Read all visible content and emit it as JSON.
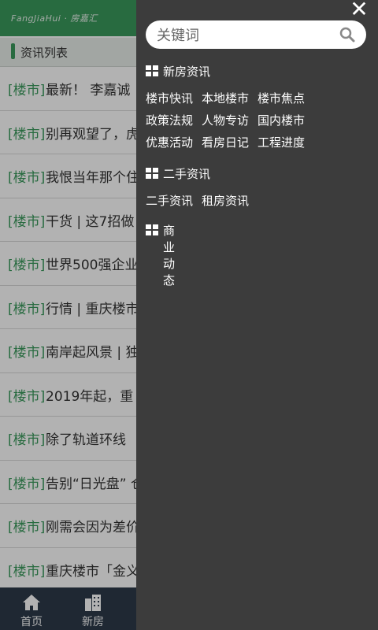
{
  "header": {
    "logo": "FangJiaHui · 房嘉汇"
  },
  "section": {
    "title": "资讯列表"
  },
  "news": [
    {
      "tag": "[楼市]",
      "title": "最新！ 李嘉诚"
    },
    {
      "tag": "[楼市]",
      "title": "别再观望了，虎"
    },
    {
      "tag": "[楼市]",
      "title": "我恨当年那个住"
    },
    {
      "tag": "[楼市]",
      "title": "干货 | 这7招做"
    },
    {
      "tag": "[楼市]",
      "title": "世界500强企业"
    },
    {
      "tag": "[楼市]",
      "title": "行情 | 重庆楼市"
    },
    {
      "tag": "[楼市]",
      "title": "南岸起风景 | 独"
    },
    {
      "tag": "[楼市]",
      "title": "2019年起，重"
    },
    {
      "tag": "[楼市]",
      "title": "除了轨道环线"
    },
    {
      "tag": "[楼市]",
      "title": "告别“日光盘” 仓"
    },
    {
      "tag": "[楼市]",
      "title": "刚需会因为差价"
    },
    {
      "tag": "[楼市]",
      "title": "重庆楼市「金义"
    }
  ],
  "bottom_nav": [
    {
      "label": "首页",
      "icon": "home-icon"
    },
    {
      "label": "新房",
      "icon": "building-icon"
    }
  ],
  "drawer": {
    "close": "✕",
    "search_placeholder": "关键词",
    "categories": [
      {
        "name": "新房资讯",
        "rows": [
          [
            "楼市快讯",
            "本地楼市",
            "楼市焦点"
          ],
          [
            "政策法规",
            "人物专访",
            "国内楼市"
          ],
          [
            "优惠活动",
            "看房日记",
            "工程进度"
          ]
        ]
      },
      {
        "name": "二手资讯",
        "rows": [
          [
            "二手资讯",
            "租房资讯"
          ]
        ]
      },
      {
        "name": "商业动态",
        "rows": []
      }
    ]
  },
  "colors": {
    "accent": "#3a9a5c",
    "drawer_bg": "#3c3c3c",
    "nav_bg": "#2d3a4a"
  }
}
